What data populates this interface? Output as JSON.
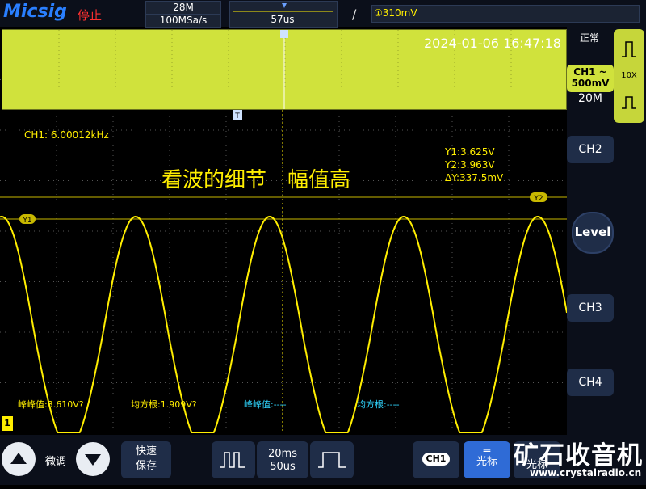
{
  "top": {
    "brand": "Micsig",
    "status": "停止",
    "memory_depth": "28M",
    "sample_rate": "100MSa/s",
    "time_position": "57us",
    "trigger_level": "①310mV"
  },
  "screen": {
    "datetime": "2024-01-06 16:47:18",
    "frequency": "CH1: 6.00012kHz",
    "annotation": "看波的细节　幅值高",
    "cursor_y1": "Y1:3.625V",
    "cursor_y2": "Y2:3.963V",
    "cursor_dy": "ΔY:337.5mV",
    "marker_y1": "Y1",
    "marker_y2": "Y2",
    "marker_t": "T",
    "ch1_marker": "1"
  },
  "measurements": {
    "m1": "峰峰值:3.610V?",
    "m2": "均方根:1.909V?",
    "m3": "峰峰值:----",
    "m4": "均方根:----"
  },
  "right_panel": {
    "trigger_mode": "正常",
    "ch1_label": "CH1 ~",
    "ch1_scale": "500mV",
    "ch1_memory": "20M",
    "probe": "10X",
    "ch2": "CH2",
    "ch3": "CH3",
    "ch4": "CH4",
    "level": "Level"
  },
  "bottom": {
    "fine_tune": "微调",
    "quick_save_1": "快速",
    "quick_save_2": "保存",
    "timebase_top": "20ms",
    "timebase_bottom": "50us",
    "ch1": "CH1",
    "cursor_label": "光标",
    "cursor2_label": "光标",
    "watermark": "矿石收音机",
    "watermark_url": "www.crystalradio.cn"
  },
  "colors": {
    "ch1": "#ffee00",
    "overview": "#d0e23c",
    "accent": "#2f6bd6",
    "status": "#ff3030",
    "measure_inactive": "#30d6ff"
  }
}
